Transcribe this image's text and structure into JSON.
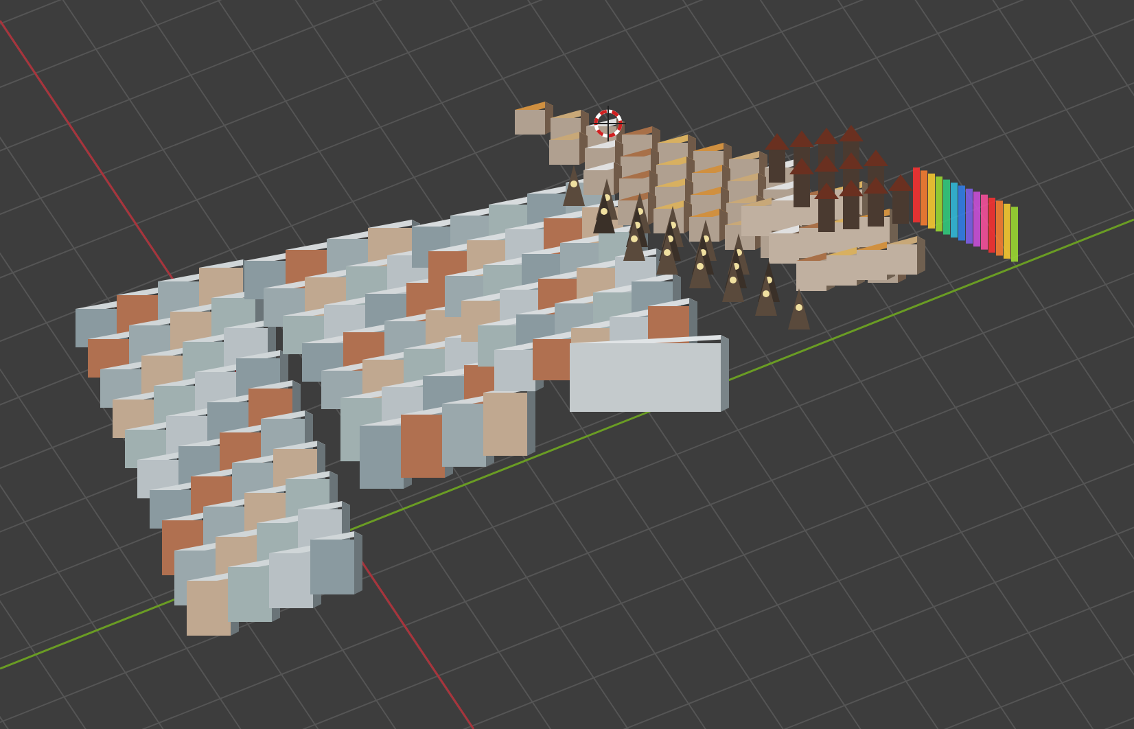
{
  "viewport": {
    "cursor_visible": true
  }
}
